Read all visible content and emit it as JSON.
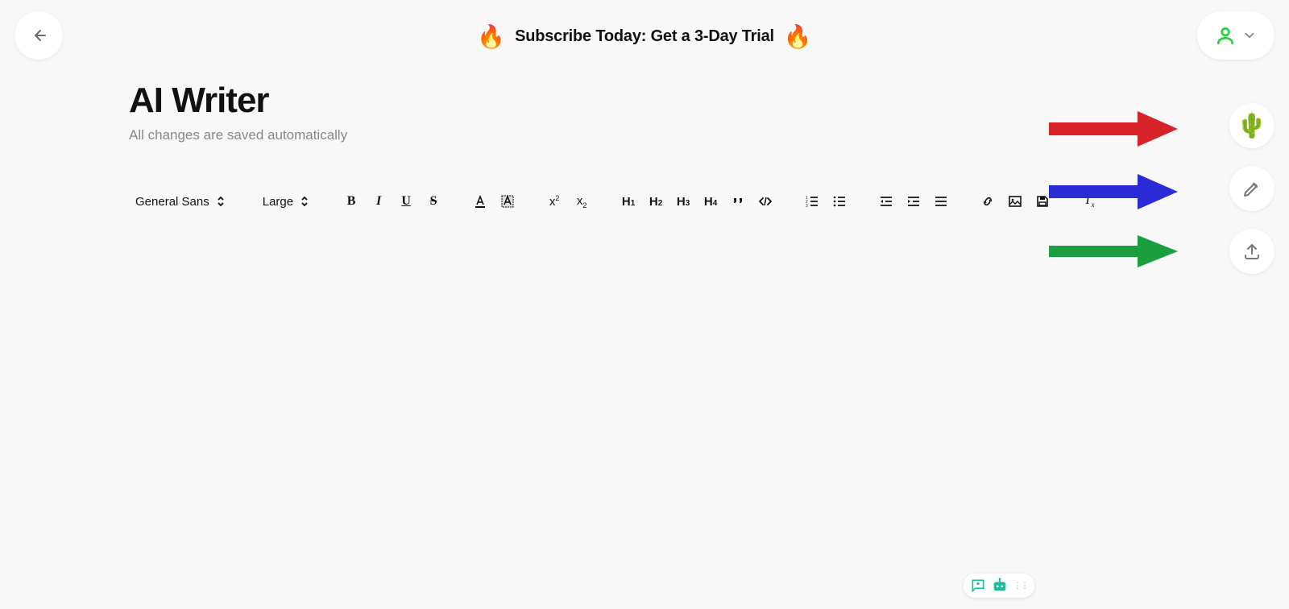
{
  "promo": {
    "label": "Subscribe Today: Get a 3-Day Trial",
    "emoji": "🔥"
  },
  "title": "AI Writer",
  "subtitle": "All changes are saved automatically",
  "toolbar": {
    "font_family": "General Sans",
    "font_size": "Large",
    "bold": "B",
    "italic": "I",
    "underline": "U",
    "strike": "S",
    "h1": "H",
    "h1n": "1",
    "h2": "H",
    "h2n": "2",
    "h3": "H",
    "h3n": "3",
    "h4": "H",
    "h4n": "4",
    "sup_base": "x",
    "sup_exp": "2",
    "sub_base": "x",
    "sub_exp": "2",
    "clear_glyph": "T",
    "clear_sub": "x"
  },
  "side": {
    "cactus": "🌵"
  },
  "annotations": {
    "arrow1_color": "#d8222a",
    "arrow2_color": "#2b2bd6",
    "arrow3_color": "#1a9e3e"
  }
}
